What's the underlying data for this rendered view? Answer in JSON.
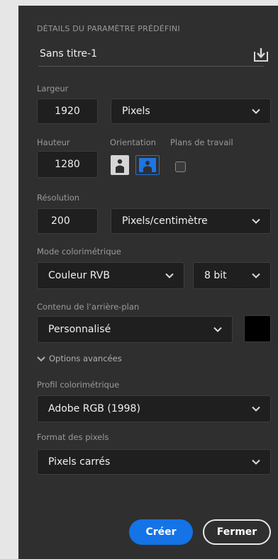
{
  "header": {
    "title": "DÉTAILS DU PARAMÈTRE PRÉDÉFINI",
    "preset_name": "Sans titre-1"
  },
  "width": {
    "label": "Largeur",
    "value": "1920",
    "unit": "Pixels"
  },
  "height": {
    "label": "Hauteur",
    "value": "1280"
  },
  "orientation": {
    "label": "Orientation"
  },
  "artboards": {
    "label": "Plans de travail"
  },
  "resolution": {
    "label": "Résolution",
    "value": "200",
    "unit": "Pixels/centimètre"
  },
  "color_mode": {
    "label": "Mode colorimétrique",
    "mode": "Couleur RVB",
    "depth": "8 bit"
  },
  "background": {
    "label": "Contenu de l’arrière-plan",
    "value": "Personnalisé",
    "swatch_color": "#000000"
  },
  "advanced": {
    "label": "Options avancées"
  },
  "color_profile": {
    "label": "Profil colorimétrique",
    "value": "Adobe RGB (1998)"
  },
  "pixel_format": {
    "label": "Format des pixels",
    "value": "Pixels carrés"
  },
  "buttons": {
    "create": "Créer",
    "close": "Fermer"
  },
  "colors": {
    "accent": "#1473e6",
    "panel": "#2f2f2f",
    "field": "#1f1f1f"
  }
}
